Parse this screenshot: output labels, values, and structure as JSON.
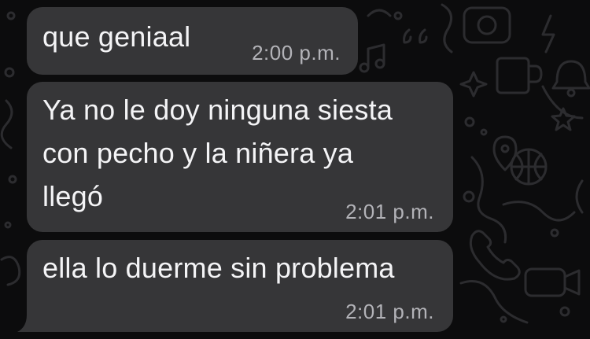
{
  "colors": {
    "background": "#0c0c0d",
    "bubble": "#363638",
    "text": "#f4f4f6",
    "timestamp": "#b3b3b8",
    "doodle_stroke": "#2c2c2f"
  },
  "wallpaper_icons": [
    "music-note-icon",
    "quote-icon",
    "sparkle-icon",
    "coffee-mug-icon",
    "bell-icon",
    "camera-icon",
    "basketball-icon",
    "lightning-icon",
    "location-pin-icon",
    "phone-icon",
    "video-icon",
    "star-icon"
  ],
  "messages": [
    {
      "text": "que geniaal",
      "time": "2:00 p.m."
    },
    {
      "text": "Ya no le doy ninguna siesta\ncon pecho y la niñera ya\nllegó",
      "time": "2:01 p.m."
    },
    {
      "text": "ella lo duerme sin problema",
      "time": "2:01 p.m."
    }
  ]
}
